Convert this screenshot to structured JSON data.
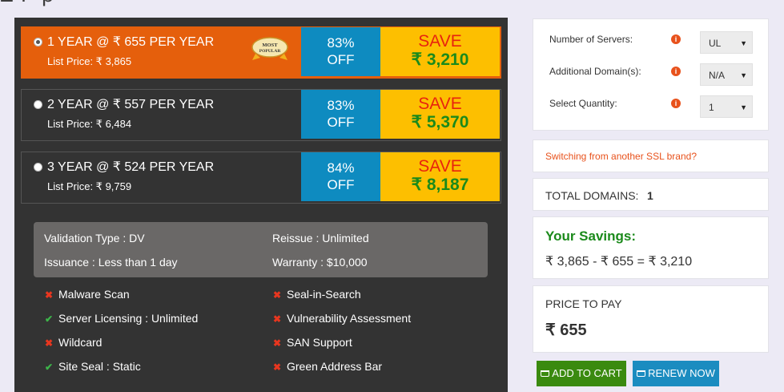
{
  "plans": [
    {
      "title": "1 YEAR @ ₹ 655 PER YEAR",
      "list_price": "List Price: ₹ 3,865",
      "off_pct": "83%",
      "off_label": "OFF",
      "save_label": "SAVE",
      "save_amount": "₹ 3,210",
      "selected": true,
      "badge_line1": "MOST",
      "badge_line2": "POPULAR"
    },
    {
      "title": "2 YEAR @ ₹ 557 PER YEAR",
      "list_price": "List Price: ₹ 6,484",
      "off_pct": "83%",
      "off_label": "OFF",
      "save_label": "SAVE",
      "save_amount": "₹ 5,370",
      "selected": false
    },
    {
      "title": "3 YEAR @ ₹ 524 PER YEAR",
      "list_price": "List Price: ₹ 9,759",
      "off_pct": "84%",
      "off_label": "OFF",
      "save_label": "SAVE",
      "save_amount": "₹ 8,187",
      "selected": false
    }
  ],
  "specs": {
    "validation": "Validation Type : DV",
    "reissue": "Reissue : Unlimited",
    "issuance": "Issuance : Less than 1 day",
    "warranty": "Warranty : $10,000"
  },
  "features": [
    {
      "label": "Malware Scan",
      "included": false
    },
    {
      "label": "Seal-in-Search",
      "included": false
    },
    {
      "label": "Server Licensing : Unlimited",
      "included": true
    },
    {
      "label": "Vulnerability Assessment",
      "included": false
    },
    {
      "label": "Wildcard",
      "included": false
    },
    {
      "label": "SAN Support",
      "included": false
    },
    {
      "label": "Site Seal : Static",
      "included": true
    },
    {
      "label": "Green Address Bar",
      "included": false
    }
  ],
  "options": {
    "servers_label": "Number of Servers:",
    "servers_value": "UL",
    "domains_label": "Additional Domain(s):",
    "domains_value": "N/A",
    "quantity_label": "Select Quantity:",
    "quantity_value": "1"
  },
  "switch_link": "Switching from another SSL brand?",
  "total_domains_label": "TOTAL DOMAINS:",
  "total_domains_value": "1",
  "savings": {
    "title": "Your Savings:",
    "formula": "₹ 3,865 - ₹ 655 = ₹ 3,210"
  },
  "price": {
    "label": "PRICE TO PAY",
    "value": "₹ 655"
  },
  "buttons": {
    "add_to_cart": "ADD TO CART",
    "renew_now": "RENEW NOW"
  },
  "colors": {
    "selected_plan": "#e55f0c",
    "off_bg": "#0e8bc0",
    "save_bg": "#fdbf00",
    "save_text": "#e8230e",
    "save_amount": "#1b8a1b",
    "add_cart_btn": "#3a8a0f",
    "renew_btn": "#1b8cc0"
  }
}
